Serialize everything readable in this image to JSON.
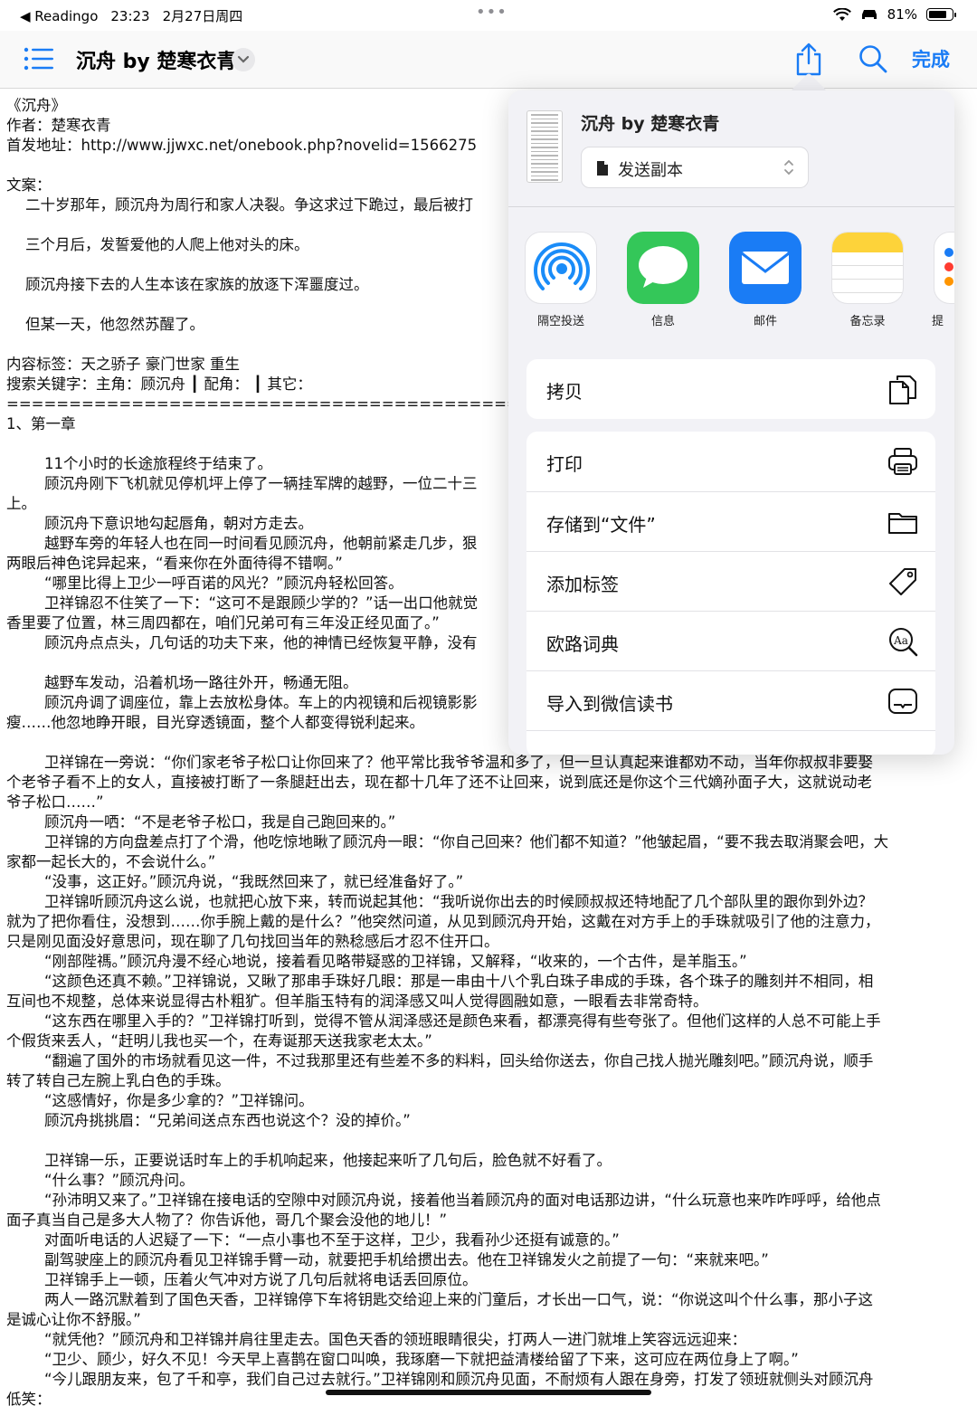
{
  "status_bar": {
    "back_app": "◀ Readingo",
    "time": "23:23",
    "date": "2月27日周四",
    "battery_percent": "81%",
    "battery_level": 0.81
  },
  "nav": {
    "title": "沉舟 by 楚寒衣青",
    "done_label": "完成"
  },
  "share_sheet": {
    "file_title": "沉舟 by 楚寒衣青",
    "send_option": "发送副本",
    "apps": [
      {
        "name": "隔空投送",
        "icon": "airdrop-icon"
      },
      {
        "name": "信息",
        "icon": "messages-icon"
      },
      {
        "name": "邮件",
        "icon": "mail-icon"
      },
      {
        "name": "备忘录",
        "icon": "notes-icon"
      },
      {
        "name": "提",
        "icon": "reminders-icon"
      }
    ],
    "actions": [
      {
        "label": "拷贝",
        "icon": "copy-icon"
      },
      {
        "label": "打印",
        "icon": "printer-icon"
      },
      {
        "label": "存储到“文件”",
        "icon": "folder-icon"
      },
      {
        "label": "添加标签",
        "icon": "tag-icon"
      },
      {
        "label": "欧路词典",
        "icon": "dictionary-icon"
      },
      {
        "label": "导入到微信读书",
        "icon": "wechat-read-icon"
      }
    ]
  },
  "document": {
    "lines": [
      "《沉舟》",
      "作者：楚寒衣青",
      "首发地址：http://www.jjwxc.net/onebook.php?novelid=1566275",
      "",
      "文案：",
      "    二十岁那年，顾沉舟为周行和家人决裂。争这求过下跪过，最后被打",
      "",
      "    三个月后，发誓爱他的人爬上他对头的床。",
      "",
      "    顾沉舟接下去的人生本该在家族的放逐下浑噩度过。",
      "",
      "    但某一天，他忽然苏醒了。",
      "",
      "内容标签：天之骄子 豪门世家 重生",
      "搜索关键字：主角：顾沉舟 ┃ 配角： ┃ 其它：",
      "================================================================",
      "1、第一章",
      "",
      "        11个小时的长途旅程终于结束了。",
      "        顾沉舟刚下飞机就见停机坪上停了一辆挂军牌的越野，一位二十三",
      "上。",
      "        顾沉舟下意识地勾起唇角，朝对方走去。",
      "        越野车旁的年轻人也在同一时间看见顾沉舟，他朝前紧走几步，狠",
      "两眼后神色诧异起来，“看来你在外面待得不错啊。”",
      "        “哪里比得上卫少一呼百诺的风光？”顾沉舟轻松回答。",
      "        卫祥锦忍不住笑了一下：“这可不是跟顾少学的？”话一出口他就觉",
      "香里要了位置，林三周四都在，咱们兄弟可有三年没正经见面了。”",
      "        顾沉舟点点头，几句话的功夫下来，他的神情已经恢复平静，没有",
      "",
      "        越野车发动，沿着机场一路往外开，畅通无阻。",
      "        顾沉舟调了调座位，靠上去放松身体。车上的内视镜和后视镜影影",
      "瘦……他忽地睁开眼，目光穿透镜面，整个人都变得锐利起来。",
      "",
      "        卫祥锦在一旁说：“你们家老爷子松口让你回来了？他平常比我爷爷温和多了，但一旦认真起来谁都劝不动，当年你叔叔非要娶",
      "个老爷子看不上的女人，直接被打断了一条腿赶出去，现在都十几年了还不让回来，说到底还是你这个三代嫡孙面子大，这就说动老",
      "爷子松口……”",
      "        顾沉舟一哂：“不是老爷子松口，我是自己跑回来的。”",
      "        卫祥锦的方向盘差点打了个滑，他吃惊地瞅了顾沉舟一眼：“你自己回来？他们都不知道？”他皱起眉，“要不我去取消聚会吧，大",
      "家都一起长大的，不会说什么。”",
      "        “没事，这正好。”顾沉舟说，“我既然回来了，就已经准备好了。”",
      "        卫祥锦听顾沉舟这么说，也就把心放下来，转而说起其他：“我听说你出去的时候顾叔叔还特地配了几个部队里的跟你到外边？",
      "就为了把你看住，没想到……你手腕上戴的是什么？”他突然问道，从见到顾沉舟开始，这戴在对方手上的手珠就吸引了他的注意力，",
      "只是刚见面没好意思问，现在聊了几句找回当年的熟稔感后才忍不住开口。",
      "        “刚部陛禡。”顾沉舟漫不经心地说，接着看见略带疑惑的卫祥锦，又解释，“收来的，一个古件，是羊脂玉。”",
      "        “这颜色还真不赖。”卫祥锦说，又瞅了那串手珠好几眼：那是一串由十八个乳白珠子串成的手珠，各个珠子的雕刻并不相同，相",
      "互间也不规整，总体来说显得古朴粗犷。但羊脂玉特有的润泽感又叫人觉得圆融如意，一眼看去非常奇特。",
      "        “这东西在哪里入手的？”卫祥锦打听到，觉得不管从润泽感还是颜色来看，都漂亮得有些夸张了。但他们这样的人总不可能上手",
      "个假货来丢人，“赶明儿我也买一个，在寿诞那天送我家老太太。”",
      "        “翻遍了国外的市场就看见这一件，不过我那里还有些差不多的料料，回头给你送去，你自己找人抛光雕刻吧。”顾沉舟说，顺手",
      "转了转自己左腕上乳白色的手珠。",
      "        “这感情好，你是多少拿的？”卫祥锦问。",
      "        顾沉舟挑挑眉：“兄弟间送点东西也说这个？没的掉价。”",
      "",
      "        卫祥锦一乐，正要说话时车上的手机响起来，他接起来听了几句后，脸色就不好看了。",
      "        “什么事？”顾沉舟问。",
      "        “孙沛明又来了。”卫祥锦在接电话的空隙中对顾沉舟说，接着他当着顾沉舟的面对电话那边讲，“什么玩意也来咋咋呼呼，给他点",
      "面子真当自己是多大人物了？你告诉他，哥几个聚会没他的地儿！”",
      "        对面听电话的人迟疑了一下：“一点小事也不至于这样，卫少，我看孙少还挺有诚意的。”",
      "        副驾驶座上的顾沉舟看见卫祥锦手臂一动，就要把手机给掼出去。他在卫祥锦发火之前提了一句：“来就来吧。”",
      "        卫祥锦手上一顿，压着火气冲对方说了几句后就将电话丢回原位。",
      "        两人一路沉默着到了国色天香，卫祥锦停下车将钥匙交给迎上来的门童后，才长出一口气，说：“你说这叫个什么事，那小子这",
      "是诚心让你不舒服。”",
      "        “就凭他？”顾沉舟和卫祥锦并肩往里走去。国色天香的领班眼睛很尖，打两人一进门就堆上笑容远远迎来：",
      "        “卫少、顾少，好久不见！今天早上喜鹊在窗口叫唤，我琢磨一下就把益清楼给留了下来，这可应在两位身上了啊。”",
      "        “今儿跟朋友来，包了千和亭，我们自己过去就行。”卫祥锦刚和顾沉舟见面，不耐烦有人跟在身旁，打发了领班就侧头对顾沉舟",
      "低笑："
    ]
  }
}
